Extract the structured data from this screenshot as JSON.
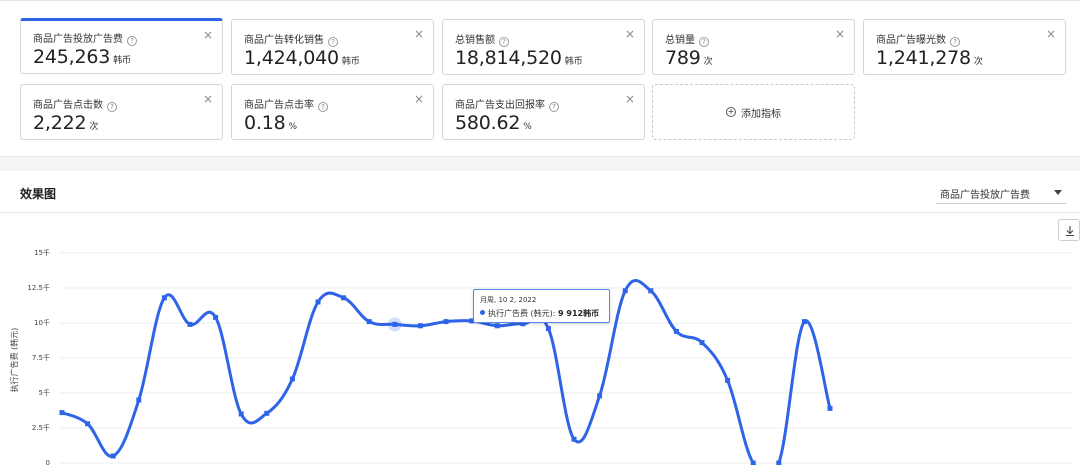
{
  "metrics": [
    {
      "label": "商品广告投放广告费",
      "value": "245,263",
      "unit": "韩币",
      "active": true
    },
    {
      "label": "商品广告转化销售",
      "value": "1,424,040",
      "unit": "韩币",
      "active": false
    },
    {
      "label": "总销售额",
      "value": "18,814,520",
      "unit": "韩币",
      "active": false
    },
    {
      "label": "总销量",
      "value": "789",
      "unit": "次",
      "active": false
    },
    {
      "label": "商品广告曝光数",
      "value": "1,241,278",
      "unit": "次",
      "active": false
    },
    {
      "label": "商品广告点击数",
      "value": "2,222",
      "unit": "次",
      "active": false
    },
    {
      "label": "商品广告点击率",
      "value": "0.18",
      "unit": "%",
      "active": false
    },
    {
      "label": "商品广告支出回报率",
      "value": "580.62",
      "unit": "%",
      "active": false
    }
  ],
  "add_metric_label": "添加指标",
  "help_glyph": "?",
  "close_glyph": "×",
  "chart_section": {
    "title": "效果图",
    "metric_select": "商品广告投放广告费",
    "tooltip": {
      "date": "月周, 10 2, 2022",
      "series_label": "执行广告费 (韩元):",
      "value": "9 912韩币"
    }
  },
  "colors": {
    "accent": "#2d64e8",
    "line": "#2d64e8"
  },
  "chart_data": {
    "type": "line",
    "ylabel": "执行广告费 (韩元)",
    "yticks": [
      "0",
      "2.5千",
      "5千",
      "7.5千",
      "10千",
      "12.5千",
      "15千"
    ],
    "ylim": [
      0,
      15000
    ],
    "grid": true,
    "series": [
      {
        "values": [
          3600,
          2800,
          500,
          4500,
          11800,
          9900,
          10400,
          3500,
          3550,
          6000,
          11500,
          11800,
          10100,
          9900,
          9800,
          10100,
          10150,
          9800,
          9950,
          9600,
          1700,
          4800,
          12300,
          12300,
          9400,
          8600,
          5900,
          0,
          0,
          10100,
          3900
        ]
      }
    ]
  }
}
